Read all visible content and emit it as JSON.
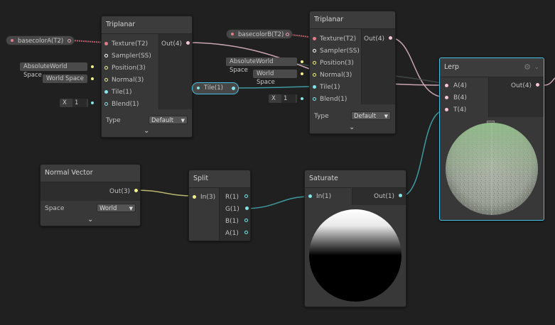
{
  "colors": {
    "background": "#202020",
    "texture": "#e07d8b",
    "sampler": "#ffffff",
    "vector3": "#f3f08a",
    "vector1": "#84e4e7",
    "vector4": "#f4c6d3",
    "selected": "#44c0e6"
  },
  "nodes": {
    "triplanar_a": {
      "title": "Triplanar",
      "inputs": [
        "Texture(T2)",
        "Sampler(SS)",
        "Position(3)",
        "Normal(3)",
        "Tile(1)",
        "Blend(1)"
      ],
      "output": "Out(4)",
      "type_label": "Type",
      "type_value": "Default",
      "blend_x": "X",
      "blend_value": "1",
      "property": "basecolorA(T2)",
      "position_ctrl": "AbsoluteWorld Space",
      "normal_ctrl": "World Space"
    },
    "triplanar_b": {
      "title": "Triplanar",
      "inputs": [
        "Texture(T2)",
        "Sampler(SS)",
        "Position(3)",
        "Normal(3)",
        "Tile(1)",
        "Blend(1)"
      ],
      "output": "Out(4)",
      "type_label": "Type",
      "type_value": "Default",
      "blend_x": "X",
      "blend_value": "1",
      "property": "basecolorB(T2)",
      "position_ctrl": "AbsoluteWorld Space",
      "normal_ctrl": "World Space"
    },
    "tile_property": {
      "label": "Tile(1)"
    },
    "lerp": {
      "title": "Lerp",
      "inputs": [
        "A(4)",
        "B(4)",
        "T(4)"
      ],
      "output": "Out(4)",
      "preview": "mossy-stone-sphere"
    },
    "normal_vector": {
      "title": "Normal Vector",
      "output": "Out(3)",
      "space_label": "Space",
      "space_value": "World"
    },
    "split": {
      "title": "Split",
      "input": "In(3)",
      "outputs": [
        "R(1)",
        "G(1)",
        "B(1)",
        "A(1)"
      ]
    },
    "saturate": {
      "title": "Saturate",
      "input": "In(1)",
      "output": "Out(1)",
      "preview": "white-to-black-gradient-sphere"
    }
  },
  "icons": {
    "lerp_gear": "gear-icon",
    "lerp_collapse": "chevron-down-icon",
    "lerp_preview_toggle": "chevron-up-icon",
    "node_expand": "chevron-down-icon"
  }
}
